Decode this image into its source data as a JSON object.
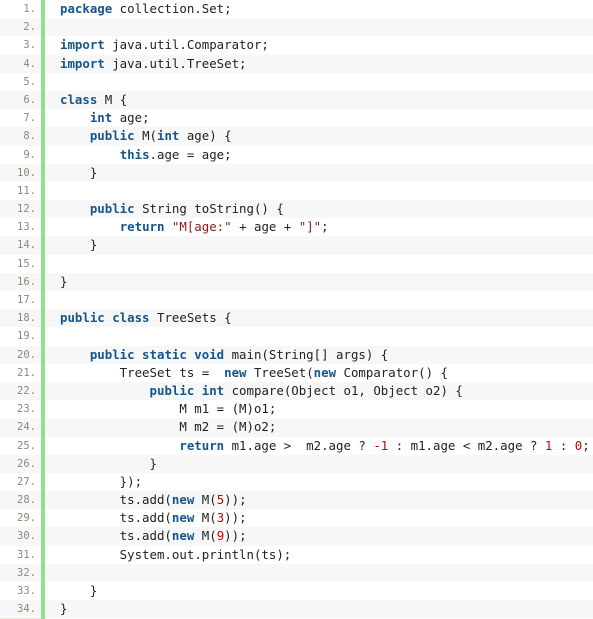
{
  "editor": {
    "language": "java",
    "package": "collection.Set",
    "total_lines": 34,
    "colors": {
      "gutter_background": "#ebebe1",
      "gutter_rule": "#8fe08f",
      "row_odd": "#ffffff",
      "row_even": "#f7f7f7",
      "line_number": "#8a8a7a",
      "keyword": "#15568c",
      "plain_text": "#222222",
      "string_literal": "#8b1a1a",
      "number_literal": "#cc0000"
    }
  },
  "lines": [
    {
      "no": "1.",
      "tokens": [
        {
          "t": "k",
          "v": "package"
        },
        {
          "t": "t",
          "v": " collection.Set;"
        }
      ]
    },
    {
      "no": "2.",
      "tokens": []
    },
    {
      "no": "3.",
      "tokens": [
        {
          "t": "k",
          "v": "import"
        },
        {
          "t": "t",
          "v": " java.util.Comparator;"
        }
      ]
    },
    {
      "no": "4.",
      "tokens": [
        {
          "t": "k",
          "v": "import"
        },
        {
          "t": "t",
          "v": " java.util.TreeSet;"
        }
      ]
    },
    {
      "no": "5.",
      "tokens": []
    },
    {
      "no": "6.",
      "tokens": [
        {
          "t": "k",
          "v": "class"
        },
        {
          "t": "t",
          "v": " M {"
        }
      ]
    },
    {
      "no": "7.",
      "tokens": [
        {
          "t": "t",
          "v": "    "
        },
        {
          "t": "k",
          "v": "int"
        },
        {
          "t": "t",
          "v": " age;"
        }
      ]
    },
    {
      "no": "8.",
      "tokens": [
        {
          "t": "t",
          "v": "    "
        },
        {
          "t": "k",
          "v": "public"
        },
        {
          "t": "t",
          "v": " M("
        },
        {
          "t": "k",
          "v": "int"
        },
        {
          "t": "t",
          "v": " age) {"
        }
      ]
    },
    {
      "no": "9.",
      "tokens": [
        {
          "t": "t",
          "v": "        "
        },
        {
          "t": "k",
          "v": "this"
        },
        {
          "t": "t",
          "v": ".age = age;"
        }
      ]
    },
    {
      "no": "10.",
      "tokens": [
        {
          "t": "t",
          "v": "    }"
        }
      ]
    },
    {
      "no": "11.",
      "tokens": []
    },
    {
      "no": "12.",
      "tokens": [
        {
          "t": "t",
          "v": "    "
        },
        {
          "t": "k",
          "v": "public"
        },
        {
          "t": "t",
          "v": " String toString() {"
        }
      ]
    },
    {
      "no": "13.",
      "tokens": [
        {
          "t": "t",
          "v": "        "
        },
        {
          "t": "k",
          "v": "return"
        },
        {
          "t": "t",
          "v": " "
        },
        {
          "t": "s",
          "v": "\"M[age:\""
        },
        {
          "t": "t",
          "v": " + age + "
        },
        {
          "t": "s",
          "v": "\"]\""
        },
        {
          "t": "t",
          "v": ";"
        }
      ]
    },
    {
      "no": "14.",
      "tokens": [
        {
          "t": "t",
          "v": "    }"
        }
      ]
    },
    {
      "no": "15.",
      "tokens": []
    },
    {
      "no": "16.",
      "tokens": [
        {
          "t": "t",
          "v": "}"
        }
      ]
    },
    {
      "no": "17.",
      "tokens": []
    },
    {
      "no": "18.",
      "tokens": [
        {
          "t": "k",
          "v": "public class"
        },
        {
          "t": "t",
          "v": " TreeSets {"
        }
      ]
    },
    {
      "no": "19.",
      "tokens": []
    },
    {
      "no": "20.",
      "tokens": [
        {
          "t": "t",
          "v": "    "
        },
        {
          "t": "k",
          "v": "public static void"
        },
        {
          "t": "t",
          "v": " main(String[] args) {"
        }
      ]
    },
    {
      "no": "21.",
      "tokens": [
        {
          "t": "t",
          "v": "        TreeSet ts =  "
        },
        {
          "t": "k",
          "v": "new"
        },
        {
          "t": "t",
          "v": " TreeSet("
        },
        {
          "t": "k",
          "v": "new"
        },
        {
          "t": "t",
          "v": " Comparator() {"
        }
      ]
    },
    {
      "no": "22.",
      "tokens": [
        {
          "t": "t",
          "v": "            "
        },
        {
          "t": "k",
          "v": "public int"
        },
        {
          "t": "t",
          "v": " compare(Object o1, Object o2) {"
        }
      ]
    },
    {
      "no": "23.",
      "tokens": [
        {
          "t": "t",
          "v": "                M m1 = (M)o1;"
        }
      ]
    },
    {
      "no": "24.",
      "tokens": [
        {
          "t": "t",
          "v": "                M m2 = (M)o2;"
        }
      ]
    },
    {
      "no": "25.",
      "tokens": [
        {
          "t": "t",
          "v": "                "
        },
        {
          "t": "k",
          "v": "return"
        },
        {
          "t": "t",
          "v": " m1.age >  m2.age ? "
        },
        {
          "t": "n",
          "v": "-1"
        },
        {
          "t": "t",
          "v": " : m1.age < m2.age ? "
        },
        {
          "t": "n",
          "v": "1"
        },
        {
          "t": "t",
          "v": " : "
        },
        {
          "t": "n",
          "v": "0"
        },
        {
          "t": "t",
          "v": ";"
        }
      ]
    },
    {
      "no": "26.",
      "tokens": [
        {
          "t": "t",
          "v": "            }"
        }
      ]
    },
    {
      "no": "27.",
      "tokens": [
        {
          "t": "t",
          "v": "        });"
        }
      ]
    },
    {
      "no": "28.",
      "tokens": [
        {
          "t": "t",
          "v": "        ts.add("
        },
        {
          "t": "k",
          "v": "new"
        },
        {
          "t": "t",
          "v": " M("
        },
        {
          "t": "n",
          "v": "5"
        },
        {
          "t": "t",
          "v": "));"
        }
      ]
    },
    {
      "no": "29.",
      "tokens": [
        {
          "t": "t",
          "v": "        ts.add("
        },
        {
          "t": "k",
          "v": "new"
        },
        {
          "t": "t",
          "v": " M("
        },
        {
          "t": "n",
          "v": "3"
        },
        {
          "t": "t",
          "v": "));"
        }
      ]
    },
    {
      "no": "30.",
      "tokens": [
        {
          "t": "t",
          "v": "        ts.add("
        },
        {
          "t": "k",
          "v": "new"
        },
        {
          "t": "t",
          "v": " M("
        },
        {
          "t": "n",
          "v": "9"
        },
        {
          "t": "t",
          "v": "));"
        }
      ]
    },
    {
      "no": "31.",
      "tokens": [
        {
          "t": "t",
          "v": "        System.out.println(ts);"
        }
      ]
    },
    {
      "no": "32.",
      "tokens": []
    },
    {
      "no": "33.",
      "tokens": [
        {
          "t": "t",
          "v": "    }"
        }
      ]
    },
    {
      "no": "34.",
      "tokens": [
        {
          "t": "t",
          "v": "}"
        }
      ]
    }
  ]
}
